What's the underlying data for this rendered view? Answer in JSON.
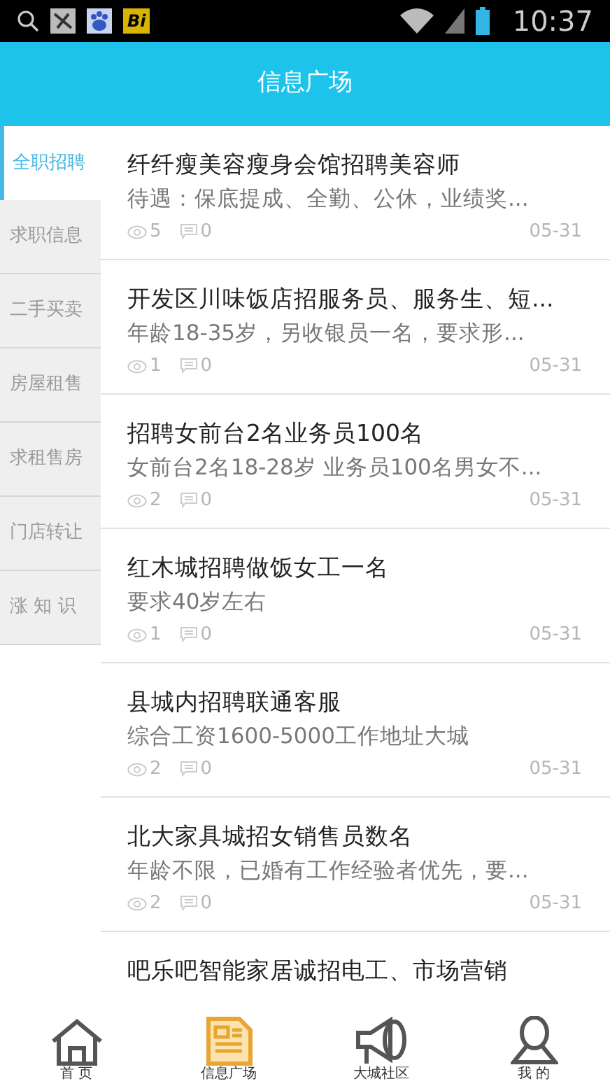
{
  "status_bar": {
    "app_badge": "Bi",
    "time": "10:37"
  },
  "header": {
    "title": "信息广场"
  },
  "sidebar": {
    "items": [
      {
        "label": "全职招聘",
        "selected": true
      },
      {
        "label": "求职信息",
        "selected": false
      },
      {
        "label": "二手买卖",
        "selected": false
      },
      {
        "label": "房屋租售",
        "selected": false
      },
      {
        "label": "求租售房",
        "selected": false
      },
      {
        "label": "门店转让",
        "selected": false
      },
      {
        "label": "涨 知 识",
        "selected": false
      }
    ]
  },
  "posts": [
    {
      "title": "纤纤瘦美容瘦身会馆招聘美容师",
      "summary": "待遇：保底提成、全勤、公休，业绩奖...",
      "views": "5",
      "comments": "0",
      "date": "05-31"
    },
    {
      "title": "开发区川味饭店招服务员、服务生、短...",
      "summary": "年龄18-35岁，另收银员一名，要求形...",
      "views": "1",
      "comments": "0",
      "date": "05-31"
    },
    {
      "title": "招聘女前台2名业务员100名",
      "summary": "女前台2名18-28岁 业务员100名男女不...",
      "views": "2",
      "comments": "0",
      "date": "05-31"
    },
    {
      "title": "红木城招聘做饭女工一名",
      "summary": "要求40岁左右",
      "views": "1",
      "comments": "0",
      "date": "05-31"
    },
    {
      "title": "县城内招聘联通客服",
      "summary": "综合工资1600-5000工作地址大城",
      "views": "2",
      "comments": "0",
      "date": "05-31"
    },
    {
      "title": "北大家具城招女销售员数名",
      "summary": "年龄不限，已婚有工作经验者优先，要...",
      "views": "2",
      "comments": "0",
      "date": "05-31"
    },
    {
      "title": "吧乐吧智能家居诚招电工、市场营销"
    }
  ],
  "tab_bar": [
    {
      "kind": "home",
      "label": "首 页",
      "selected": false
    },
    {
      "kind": "news",
      "label": "信息广场",
      "selected": true
    },
    {
      "kind": "megaphone",
      "label": "大城社区",
      "selected": false
    },
    {
      "kind": "person",
      "label": "我 的",
      "selected": false
    }
  ]
}
